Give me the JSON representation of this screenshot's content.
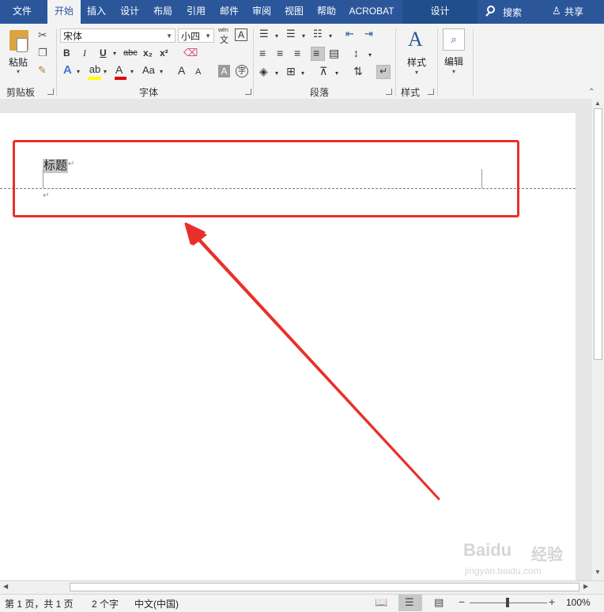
{
  "tabs": [
    "文件",
    "开始",
    "插入",
    "设计",
    "布局",
    "引用",
    "邮件",
    "审阅",
    "视图",
    "帮助",
    "ACROBAT"
  ],
  "context_tab": "设计",
  "search": "搜索",
  "share": "共享",
  "clipboard": {
    "paste": "粘贴",
    "label": "剪贴板"
  },
  "font": {
    "name": "宋体",
    "size": "小四",
    "label": "字体",
    "bold": "B",
    "italic": "I",
    "underline": "U",
    "strike": "abc",
    "sub": "x₂",
    "sup": "x²",
    "case": "Aa",
    "grow": "A",
    "shrink": "A",
    "clear": "A",
    "pinyin": "wén",
    "pinyin_char": "文",
    "border": "A",
    "color_letter": "A",
    "circle_char": "字"
  },
  "paragraph": {
    "label": "段落"
  },
  "styles": {
    "button": "样式",
    "label": "样式"
  },
  "editing": {
    "button": "编辑"
  },
  "document": {
    "heading": "标题",
    "para_mark": "↵"
  },
  "status": {
    "page": "第 1 页，共 1 页",
    "words": "2 个字",
    "language": "中文(中国)",
    "zoom": "100%"
  },
  "watermark": {
    "brand": "Baidu",
    "site": "经验",
    "url": "jingyan.baidu.com"
  },
  "colors": {
    "accent": "#2b579a",
    "highlight": "#ffff00",
    "font_color": "#e00000",
    "annotation": "#e8302a"
  }
}
